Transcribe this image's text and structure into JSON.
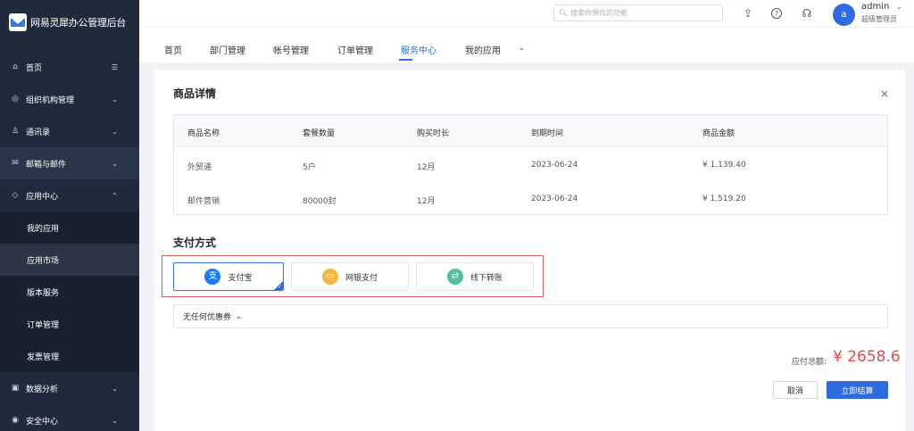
{
  "app": {
    "title": "网易灵犀办公管理后台"
  },
  "sidebar": {
    "items": [
      {
        "label": "首页",
        "icon": "home-icon",
        "glyph": "⌂",
        "arrow": "☰"
      },
      {
        "label": "组织机构管理",
        "icon": "org-icon",
        "glyph": "◎",
        "arrow": "⌄"
      },
      {
        "label": "通讯录",
        "icon": "contacts-icon",
        "glyph": "♙",
        "arrow": "⌄"
      },
      {
        "label": "邮箱与邮件",
        "icon": "mail-icon",
        "glyph": "✉",
        "arrow": "⌄"
      },
      {
        "label": "应用中心",
        "icon": "app-center-icon",
        "glyph": "◇",
        "arrow": "⌃"
      },
      {
        "label": "我的应用"
      },
      {
        "label": "应用市场"
      },
      {
        "label": "版本服务"
      },
      {
        "label": "订单管理"
      },
      {
        "label": "发票管理"
      },
      {
        "label": "数据分析",
        "icon": "chart-icon",
        "glyph": "▣",
        "arrow": "⌄"
      },
      {
        "label": "安全中心",
        "icon": "security-icon",
        "glyph": "◉",
        "arrow": "⌄"
      }
    ]
  },
  "header": {
    "search_placeholder": "搜索你想找的功能",
    "user": {
      "avatar_letter": "a",
      "name": "admin",
      "role": "超级管理员"
    }
  },
  "tabs": [
    {
      "label": "首页"
    },
    {
      "label": "部门管理"
    },
    {
      "label": "帐号管理"
    },
    {
      "label": "订单管理"
    },
    {
      "label": "服务中心"
    },
    {
      "label": "我的应用"
    }
  ],
  "product": {
    "title": "商品详情",
    "columns": [
      "商品名称",
      "套餐数量",
      "购买时长",
      "到期时间",
      "商品金额"
    ],
    "rows": [
      [
        "外贸通",
        "5户",
        "12月",
        "2023-06-24",
        "¥ 1,139.40"
      ],
      [
        "邮件营销",
        "80000封",
        "12月",
        "2023-06-24",
        "¥ 1,519.20"
      ]
    ]
  },
  "payment": {
    "title": "支付方式",
    "options": [
      {
        "label": "支付宝",
        "icon": "alipay-icon",
        "glyph": "支",
        "color": "#1677ff"
      },
      {
        "label": "网银支付",
        "icon": "bank-card-icon",
        "glyph": "▭",
        "color": "#f6b73c"
      },
      {
        "label": "线下转账",
        "icon": "transfer-icon",
        "glyph": "⇄",
        "color": "#52c29a"
      }
    ],
    "selected": "支付宝"
  },
  "coupon": {
    "label": "无任何优惠券"
  },
  "total": {
    "label": "应付总额:",
    "amount": "¥ 2658.6"
  },
  "actions": {
    "cancel": "取消",
    "confirm": "立即结算"
  },
  "colors": {
    "primary": "#2f6bde",
    "sidebar_bg": "#1f2b3d",
    "price_red": "#e84a4a",
    "highlight_border": "#e45b5b"
  }
}
